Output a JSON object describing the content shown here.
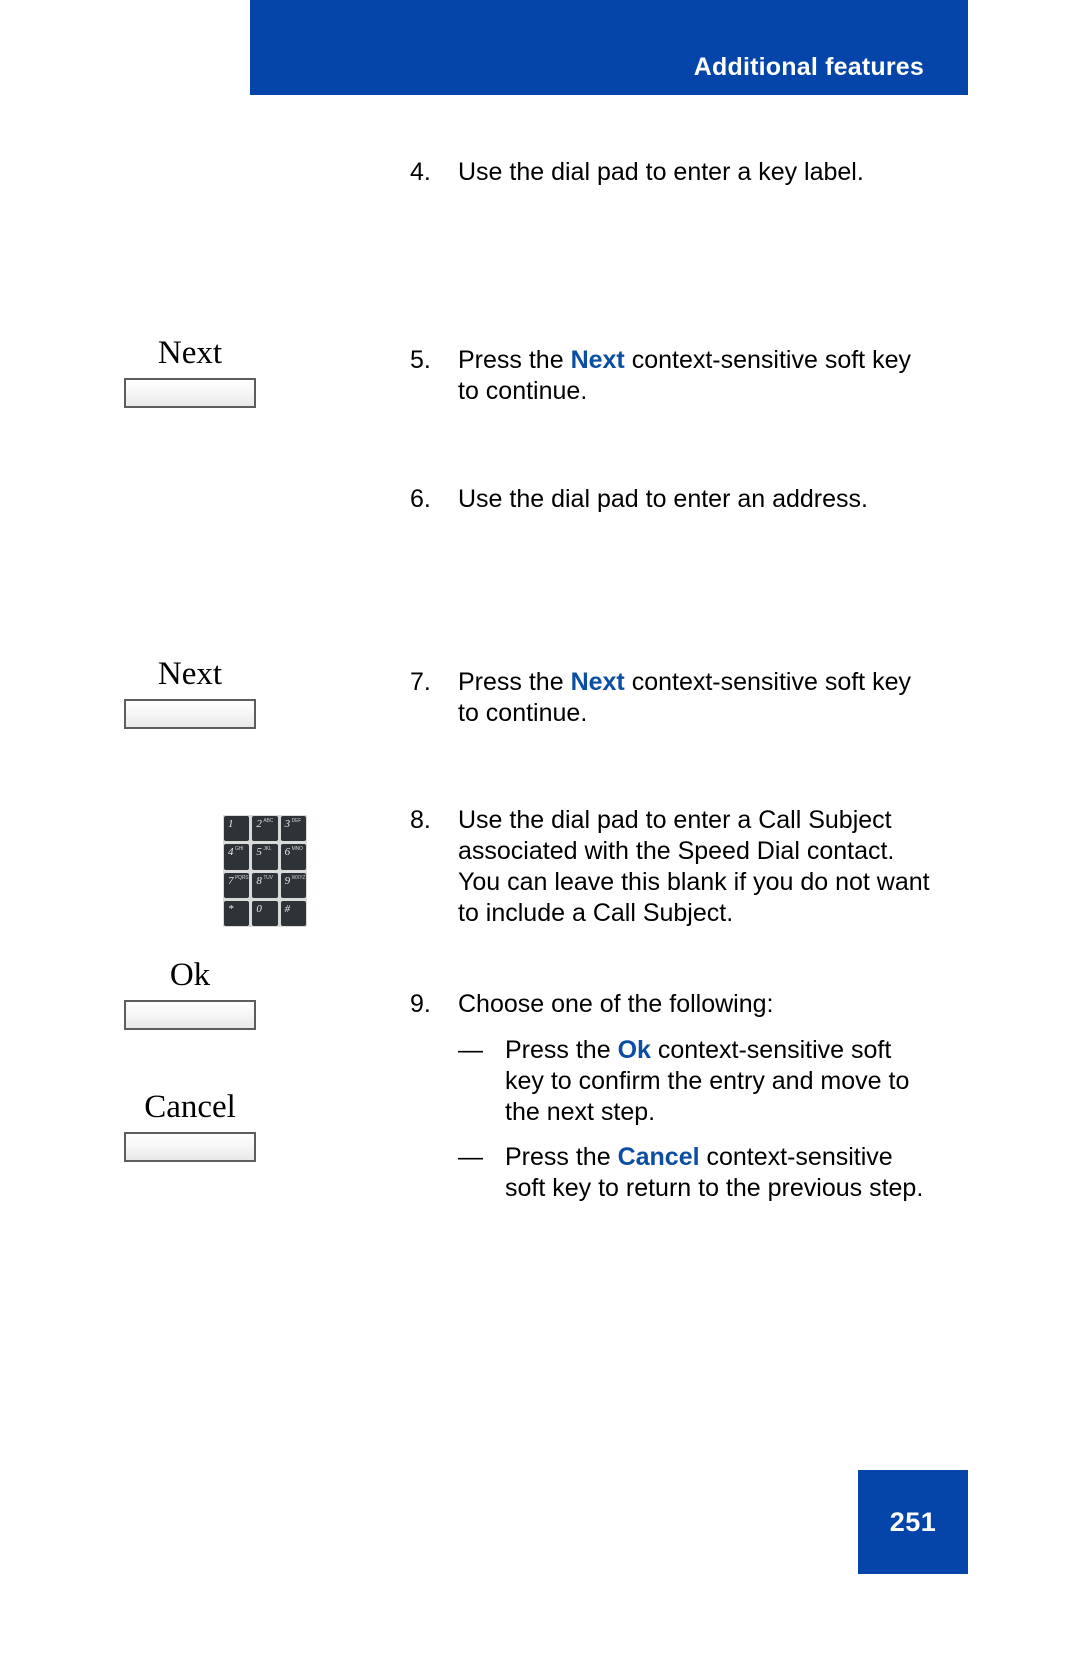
{
  "header": {
    "title": "Additional features",
    "banner_color": "#0544a8"
  },
  "accent_color": "#0b4ea2",
  "softkeys": [
    {
      "label": "Next",
      "name": "next"
    },
    {
      "label": "Next",
      "name": "next"
    },
    {
      "label": "Ok",
      "name": "ok"
    },
    {
      "label": "Cancel",
      "name": "cancel"
    }
  ],
  "dialpad": {
    "name": "dial-pad-icon",
    "keys": [
      {
        "num": "1",
        "sub": ""
      },
      {
        "num": "2",
        "sub": "ABC"
      },
      {
        "num": "3",
        "sub": "DEF"
      },
      {
        "num": "4",
        "sub": "GHI"
      },
      {
        "num": "5",
        "sub": "JKL"
      },
      {
        "num": "6",
        "sub": "MNO"
      },
      {
        "num": "7",
        "sub": "PQRS"
      },
      {
        "num": "8",
        "sub": "TUV"
      },
      {
        "num": "9",
        "sub": "WXYZ"
      },
      {
        "num": "*",
        "sub": ""
      },
      {
        "num": "0",
        "sub": ""
      },
      {
        "num": "#",
        "sub": ""
      }
    ]
  },
  "steps": [
    {
      "number": "4.",
      "parts": [
        {
          "t": "Use the dial pad to enter a key label.",
          "kw": false
        }
      ]
    },
    {
      "number": "5.",
      "parts": [
        {
          "t": "Press the ",
          "kw": false
        },
        {
          "t": "Next",
          "kw": true
        },
        {
          "t": " context-sensitive soft key to continue.",
          "kw": false
        }
      ]
    },
    {
      "number": "6.",
      "parts": [
        {
          "t": "Use the dial pad to enter an address.",
          "kw": false
        }
      ]
    },
    {
      "number": "7.",
      "parts": [
        {
          "t": "Press the ",
          "kw": false
        },
        {
          "t": "Next",
          "kw": true
        },
        {
          "t": " context-sensitive soft key to continue.",
          "kw": false
        }
      ]
    },
    {
      "number": "8.",
      "parts": [
        {
          "t": "Use the dial pad to enter a Call Subject associated with the Speed Dial contact. You can leave this blank if you do not want to include a Call Subject.",
          "kw": false
        }
      ]
    },
    {
      "number": "9.",
      "parts": [
        {
          "t": "Choose one of the following:",
          "kw": false
        }
      ]
    }
  ],
  "sub_items": [
    {
      "dash": "—",
      "parts": [
        {
          "t": "Press the ",
          "kw": false
        },
        {
          "t": "Ok",
          "kw": true
        },
        {
          "t": " context-sensitive soft key to confirm the entry and move to the next step.",
          "kw": false
        }
      ]
    },
    {
      "dash": "—",
      "parts": [
        {
          "t": "Press the ",
          "kw": false
        },
        {
          "t": "Cancel",
          "kw": true
        },
        {
          "t": " context-sensitive soft key to return to the previous step.",
          "kw": false
        }
      ]
    }
  ],
  "footer": {
    "page_number": "251"
  }
}
